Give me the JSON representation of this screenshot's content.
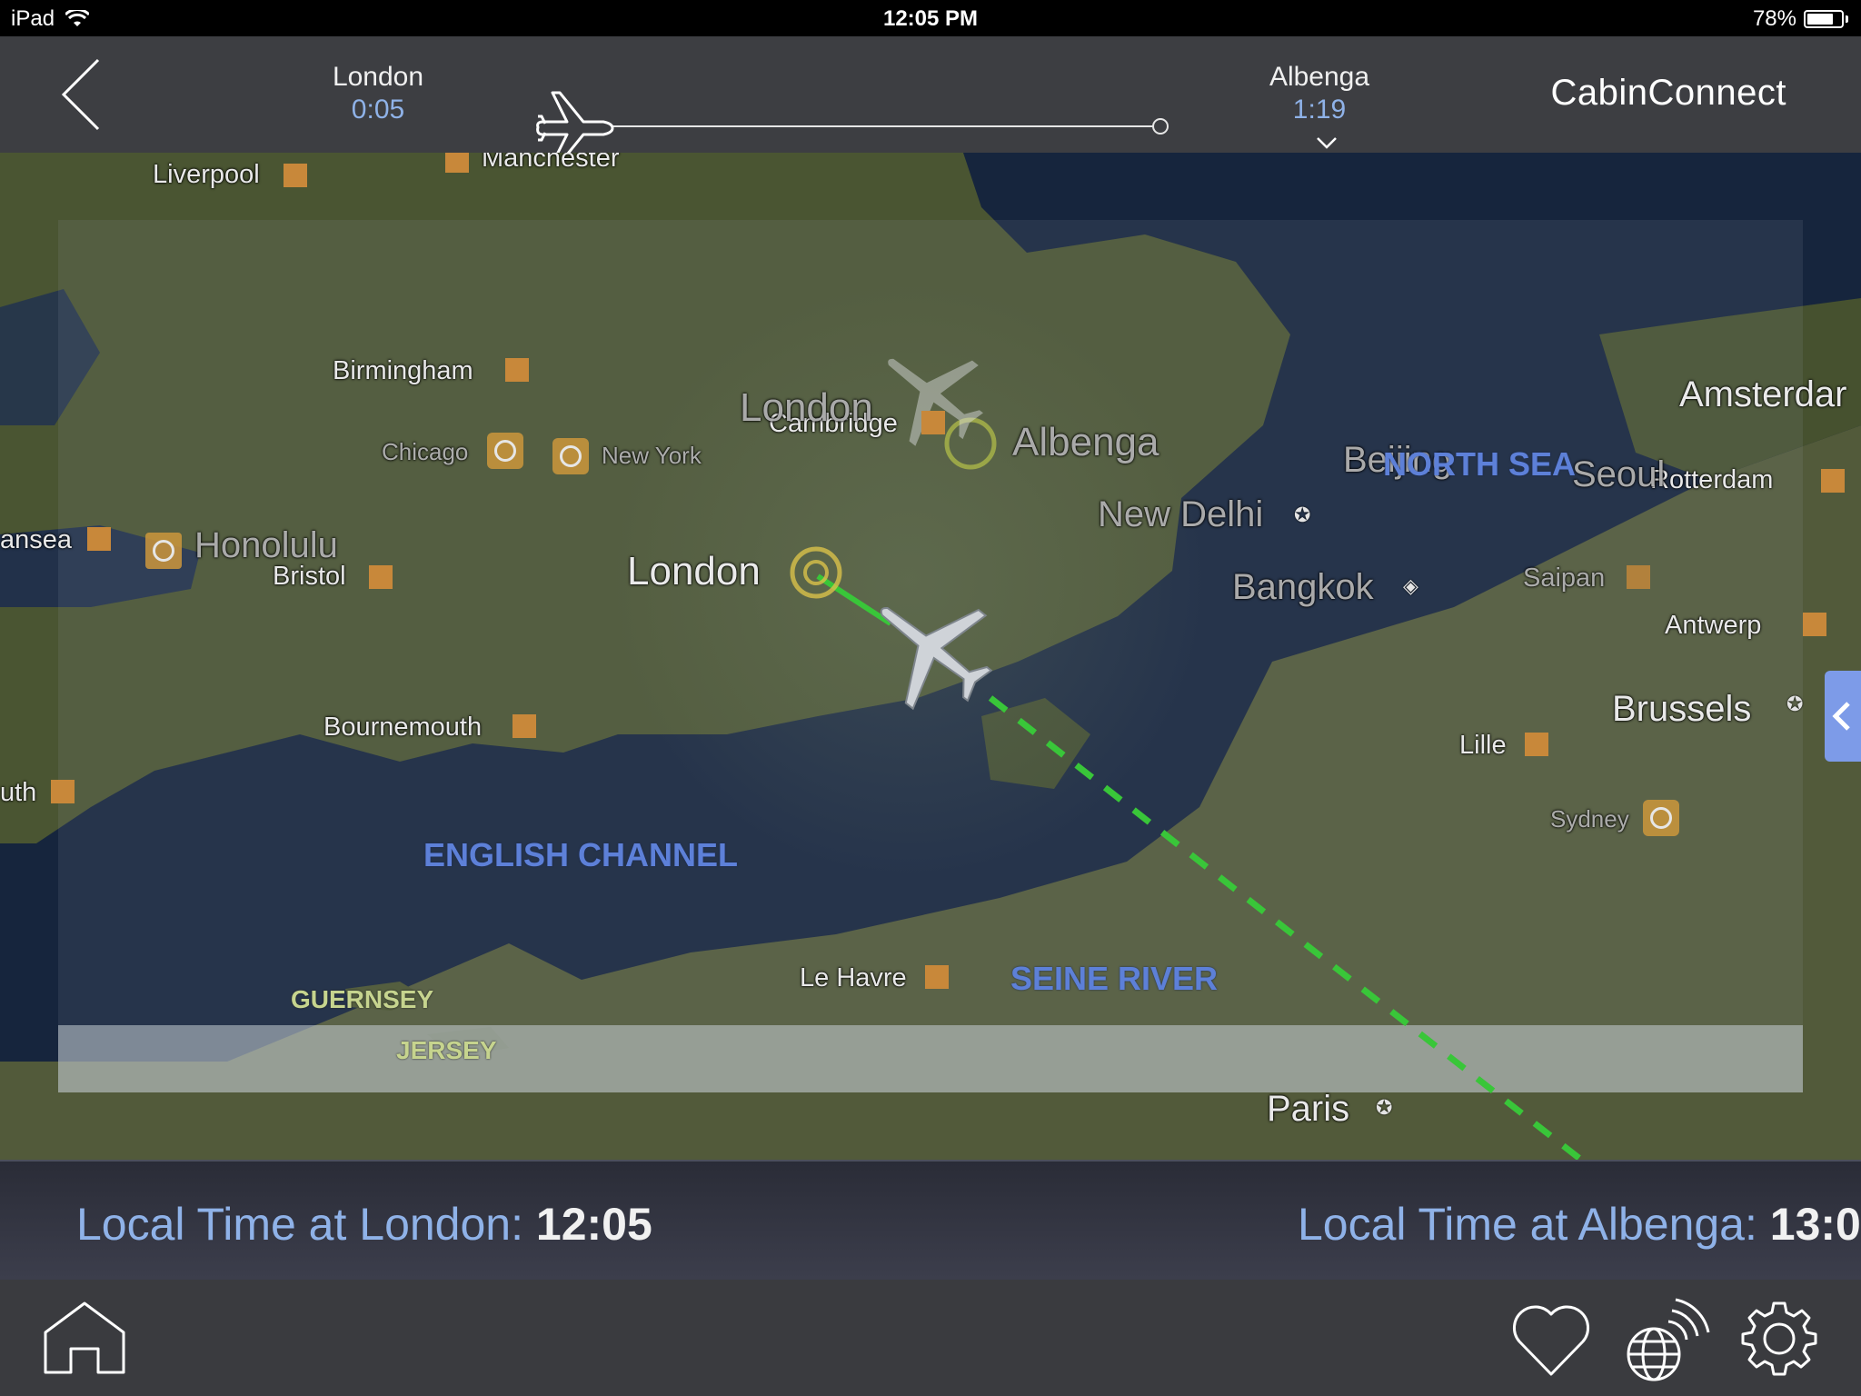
{
  "status_bar": {
    "device": "iPad",
    "time": "12:05 PM",
    "battery": "78%",
    "battery_level": 0.78
  },
  "header": {
    "origin": {
      "name": "London",
      "time": "0:05"
    },
    "destination": {
      "name": "Albenga",
      "time": "1:19"
    },
    "brand": "CabinConnect",
    "flight_progress": 0.02
  },
  "map": {
    "cities": {
      "liverpool": "Liverpool",
      "manchester": "Manchester",
      "birmingham": "Birmingham",
      "swansea": "ansea",
      "bristol": "Bristol",
      "bournemouth": "Bournemouth",
      "plymouth": "uth",
      "cambridge": "Cambridge",
      "amsterdam": "Amsterdar",
      "rotterdam": "Rotterdam",
      "antwerp": "Antwerp",
      "brussels": "Brussels",
      "lille": "Lille",
      "le_havre": "Le Havre",
      "paris": "Paris"
    },
    "reference_cities": {
      "london_big": "London",
      "london_faint": "London",
      "albenga": "Albenga",
      "chicago": "Chicago",
      "new_york": "New York",
      "honolulu": "Honolulu",
      "new_delhi": "New Delhi",
      "bangkok": "Bangkok",
      "beijing": "Beijing",
      "seoul": "Seoul",
      "saipan": "Saipan",
      "sydney": "Sydney"
    },
    "water": {
      "north_sea": "NORTH SEA",
      "english_channel": "ENGLISH CHANNEL",
      "seine": "SEINE RIVER"
    },
    "islands": {
      "guernsey": "GUERNSEY",
      "jersey": "JERSEY"
    }
  },
  "local_time": {
    "origin_prefix": "Local Time at London: ",
    "origin_time": "12:05",
    "dest_prefix": "Local Time at Albenga: ",
    "dest_time": "13:0"
  },
  "colors": {
    "accent": "#8fb2e8",
    "route": "#39c639",
    "marker": "#c8883a",
    "header_bg": "#3d3e42"
  },
  "toolbar": {
    "icons": [
      "home-icon",
      "heart-icon",
      "globe-wifi-icon",
      "gear-icon"
    ]
  }
}
